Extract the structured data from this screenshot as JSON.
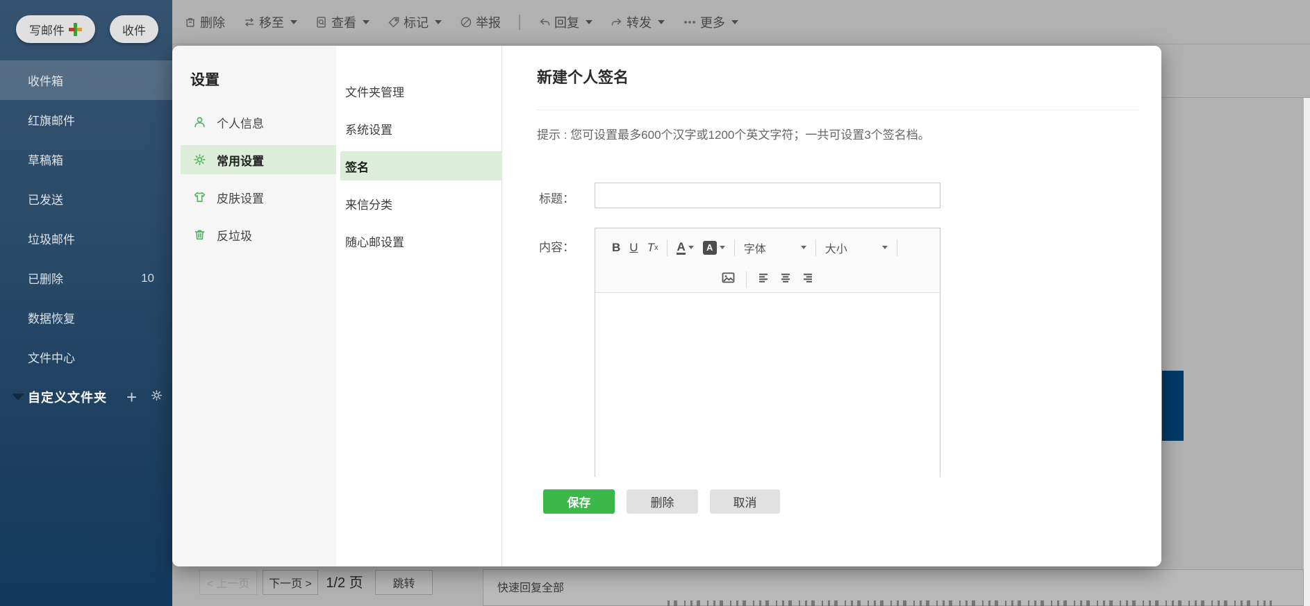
{
  "sidebar": {
    "compose_button": "写邮件",
    "receive_button": "收件",
    "folders": [
      {
        "label": "收件箱",
        "selected": true
      },
      {
        "label": "红旗邮件"
      },
      {
        "label": "草稿箱"
      },
      {
        "label": "已发送"
      },
      {
        "label": "垃圾邮件"
      },
      {
        "label": "已删除",
        "count": "10"
      },
      {
        "label": "数据恢复"
      },
      {
        "label": "文件中心"
      }
    ],
    "custom_folders_label": "自定义文件夹"
  },
  "toolbar": {
    "delete": "删除",
    "move": "移至",
    "view": "查看",
    "mark": "标记",
    "report": "举报",
    "reply": "回复",
    "forward": "转发",
    "more": "更多"
  },
  "settings_dialog": {
    "title": "设置",
    "close_icon": "×",
    "menu": [
      {
        "label": "个人信息",
        "icon": "user-icon"
      },
      {
        "label": "常用设置",
        "icon": "gear-icon",
        "selected": true
      },
      {
        "label": "皮肤设置",
        "icon": "shirt-icon"
      },
      {
        "label": "反垃圾",
        "icon": "trash-icon"
      }
    ],
    "submenu": [
      {
        "label": "文件夹管理"
      },
      {
        "label": "系统设置"
      },
      {
        "label": "签名",
        "selected": true
      },
      {
        "label": "来信分类"
      },
      {
        "label": "随心邮设置"
      }
    ]
  },
  "signature_panel": {
    "title": "新建个人签名",
    "hint": "提示 : 您可设置最多600个汉字或1200个英文字符；一共可设置3个签名档。",
    "title_field_label": "标题：",
    "content_field_label": "内容：",
    "title_field_value": "",
    "editor": {
      "bold": "B",
      "underline": "U",
      "clear_format": "T",
      "clear_format_sub": "x",
      "font_color": "A",
      "bg_color": "A",
      "font_family_dropdown": "字体",
      "font_size_dropdown": "大小",
      "content_value": ""
    },
    "save_button": "保存",
    "delete_button": "删除",
    "cancel_button": "取消"
  },
  "pagination": {
    "prev": "< 上一页",
    "next": "下一页 >",
    "page_indicator": "1/2 页",
    "jump": "跳转"
  },
  "quick_reply_label": "快速回复全部",
  "colors": {
    "accent_green": "#3cb84a",
    "menu_highlight": "#dcedd9",
    "icon_green": "#57b561",
    "sidebar_top": "#35536f",
    "sidebar_bottom": "#123a5d",
    "dim_background": "#b1b1b1",
    "navy_block": "#003a68"
  }
}
